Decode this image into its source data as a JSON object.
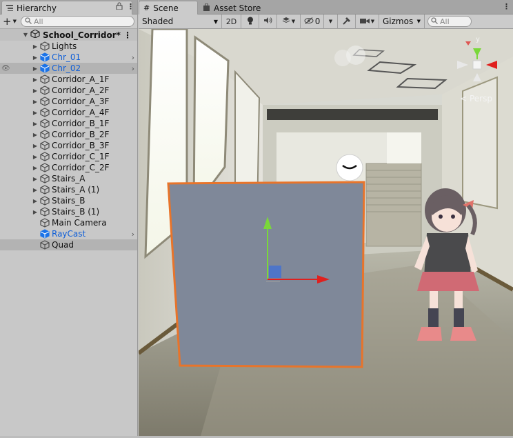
{
  "hierarchy": {
    "tab_label": "Hierarchy",
    "search_placeholder": "All",
    "scene_name": "School_Corridor*",
    "items": [
      {
        "label": "Lights",
        "expandable": true,
        "blue": false
      },
      {
        "label": "Chr_01",
        "expandable": true,
        "blue": true,
        "chevron": true
      },
      {
        "label": "Chr_02",
        "expandable": true,
        "blue": true,
        "chevron": true,
        "highlight": true
      },
      {
        "label": "Corridor_A_1F",
        "expandable": true,
        "blue": false
      },
      {
        "label": "Corridor_A_2F",
        "expandable": true,
        "blue": false
      },
      {
        "label": "Corridor_A_3F",
        "expandable": true,
        "blue": false
      },
      {
        "label": "Corridor_A_4F",
        "expandable": true,
        "blue": false
      },
      {
        "label": "Corridor_B_1F",
        "expandable": true,
        "blue": false
      },
      {
        "label": "Corridor_B_2F",
        "expandable": true,
        "blue": false
      },
      {
        "label": "Corridor_B_3F",
        "expandable": true,
        "blue": false
      },
      {
        "label": "Corridor_C_1F",
        "expandable": true,
        "blue": false
      },
      {
        "label": "Corridor_C_2F",
        "expandable": true,
        "blue": false
      },
      {
        "label": "Stairs_A",
        "expandable": true,
        "blue": false
      },
      {
        "label": "Stairs_A (1)",
        "expandable": true,
        "blue": false
      },
      {
        "label": "Stairs_B",
        "expandable": true,
        "blue": false
      },
      {
        "label": "Stairs_B (1)",
        "expandable": true,
        "blue": false
      },
      {
        "label": "Main Camera",
        "expandable": false,
        "blue": false
      },
      {
        "label": "RayCast",
        "expandable": false,
        "blue": true,
        "chevron": true
      },
      {
        "label": "Quad",
        "expandable": false,
        "blue": false,
        "selected": true
      }
    ]
  },
  "scene_view": {
    "tabs": [
      {
        "label": "Scene",
        "icon": "grid-icon"
      },
      {
        "label": "Asset Store",
        "icon": "store-bag-icon"
      }
    ],
    "shading_mode": "Shaded",
    "mode_2d": "2D",
    "hidden_count": "0",
    "gizmos_label": "Gizmos",
    "search_placeholder": "All",
    "projection_label": "< Persp",
    "gizmo_axis_label": "y"
  },
  "colors": {
    "selection_outline": "#e8742a",
    "quad_fill": "#7f8899",
    "axis_x": "#e0201e",
    "axis_y": "#7ad83a",
    "axis_z": "#3d6fd8",
    "blue_label": "#0f5fd8"
  }
}
